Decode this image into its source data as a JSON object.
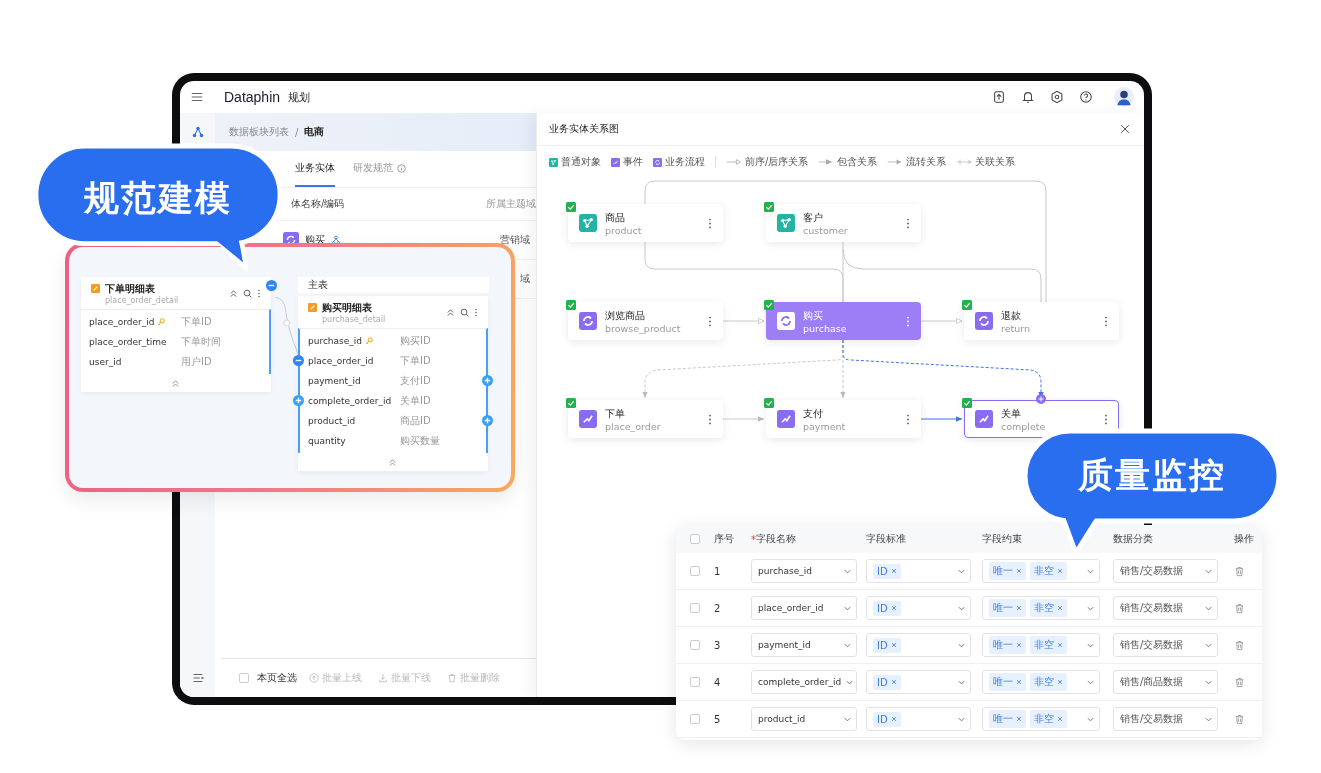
{
  "topbar": {
    "logo": "Dataphin",
    "module": "规划"
  },
  "breadcrumb": {
    "items": [
      "数据板块列表",
      "电商"
    ],
    "separator": "/"
  },
  "tabs": [
    {
      "label": "业务实体",
      "selected": true,
      "info": false
    },
    {
      "label": "研发规范",
      "selected": false,
      "info": true
    }
  ],
  "entity_table": {
    "columns": [
      "体名称/编码",
      "所属主题域"
    ],
    "rows": [
      {
        "name": "购买",
        "domain": "营销域"
      },
      {
        "domain": "域"
      }
    ]
  },
  "footer": {
    "select_all": {
      "label": "本页全选",
      "checked": false
    },
    "actions": [
      {
        "label": "批量上线",
        "kind": "upload",
        "disabled": true
      },
      {
        "label": "批量下线",
        "kind": "download",
        "disabled": true
      },
      {
        "label": "批量删除",
        "kind": "delete",
        "disabled": true
      }
    ]
  },
  "diagram": {
    "title": "业务实体关系图",
    "legend": [
      {
        "label": "普通对象",
        "kind": "object"
      },
      {
        "label": "事件",
        "kind": "event"
      },
      {
        "label": "业务流程",
        "kind": "process"
      },
      {
        "label": "前序/后序关系",
        "kind": "sequence"
      },
      {
        "label": "包含关系",
        "kind": "contain"
      },
      {
        "label": "流转关系",
        "kind": "flow"
      },
      {
        "label": "关联关系",
        "kind": "association"
      }
    ],
    "rows": [
      [
        {
          "name": "商品",
          "code": "product",
          "kind": "object",
          "checked": true,
          "selected": false,
          "highlighted": false
        },
        {
          "name": "客户",
          "code": "customer",
          "kind": "object",
          "checked": true,
          "selected": false,
          "highlighted": false
        }
      ],
      [
        {
          "name": "浏览商品",
          "code": "browse_product",
          "kind": "process",
          "checked": true,
          "selected": false,
          "highlighted": false
        },
        {
          "name": "购买",
          "code": "purchase",
          "kind": "process",
          "checked": true,
          "selected": true,
          "highlighted": false
        },
        {
          "name": "退款",
          "code": "return",
          "kind": "process",
          "checked": true,
          "selected": false,
          "highlighted": false
        }
      ],
      [
        {
          "name": "下单",
          "code": "place_order",
          "kind": "event",
          "checked": true,
          "selected": false,
          "highlighted": false
        },
        {
          "name": "支付",
          "code": "payment",
          "kind": "event",
          "checked": true,
          "selected": false,
          "highlighted": false
        },
        {
          "name": "关单",
          "code": "complete",
          "kind": "event",
          "checked": true,
          "selected": false,
          "highlighted": true
        }
      ]
    ]
  },
  "modeling_bubble": {
    "text": "规范建模"
  },
  "modeling_card": {
    "tables": [
      {
        "title": "下单明细表",
        "code": "place_order_detail",
        "port": true,
        "port_expanded": true,
        "fields": [
          {
            "name": "place_order_id",
            "comment": "下单ID",
            "primary_key": true
          },
          {
            "name": "place_order_time",
            "comment": "下单时间",
            "primary_key": false
          },
          {
            "name": "user_id",
            "comment": "用户ID",
            "primary_key": false
          }
        ]
      },
      {
        "label": "主表",
        "title": "购买明细表",
        "code": "purchase_detail",
        "fields": [
          {
            "name": "purchase_id",
            "comment": "购买ID",
            "primary_key": true
          },
          {
            "name": "place_order_id",
            "comment": "下单ID",
            "primary_key": false,
            "left_port": true,
            "left_expanded": true
          },
          {
            "name": "payment_id",
            "comment": "支付ID",
            "primary_key": false,
            "right_port": true,
            "right_expanded": false
          },
          {
            "name": "complete_order_id",
            "comment": "关单ID",
            "primary_key": false,
            "left_port": true,
            "left_expanded": false
          },
          {
            "name": "product_id",
            "comment": "商品ID",
            "primary_key": false,
            "right_port": true,
            "right_expanded": false
          },
          {
            "name": "quantity",
            "comment": "购买数量",
            "primary_key": false
          }
        ]
      }
    ]
  },
  "quality_bubble": {
    "text": "质量监控"
  },
  "field_table": {
    "required_mark": "*",
    "all_checked": false,
    "columns": {
      "index": "序号",
      "name": "字段名称",
      "standard": "字段标准",
      "constraint": "字段约束",
      "category": "数据分类",
      "action": "操作"
    },
    "rows": [
      {
        "index": "1",
        "name": "purchase_id",
        "standards": [
          "ID"
        ],
        "constraints": [
          "唯一",
          "非空"
        ],
        "category": "销售/交易数据",
        "checked": false
      },
      {
        "index": "2",
        "name": "place_order_id",
        "standards": [
          "ID"
        ],
        "constraints": [
          "唯一",
          "非空"
        ],
        "category": "销售/交易数据",
        "checked": false
      },
      {
        "index": "3",
        "name": "payment_id",
        "standards": [
          "ID"
        ],
        "constraints": [
          "唯一",
          "非空"
        ],
        "category": "销售/交易数据",
        "checked": false
      },
      {
        "index": "4",
        "name": "complete_order_id",
        "standards": [
          "ID"
        ],
        "constraints": [
          "唯一",
          "非空"
        ],
        "category": "销售/商品数据",
        "checked": false
      },
      {
        "index": "5",
        "name": "product_id",
        "standards": [
          "ID"
        ],
        "constraints": [
          "唯一",
          "非空"
        ],
        "category": "销售/交易数据",
        "checked": false
      }
    ]
  }
}
